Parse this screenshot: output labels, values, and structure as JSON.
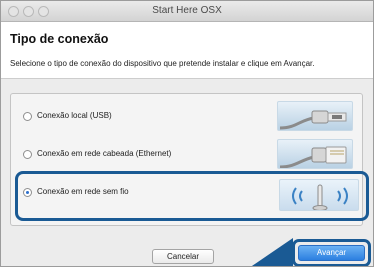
{
  "window": {
    "title": "Start Here OSX"
  },
  "header": {
    "title": "Tipo de conexão",
    "instruction": "Selecione o tipo de conexão do dispositivo que pretende instalar e clique em Avançar."
  },
  "options": [
    {
      "label": "Conexão local (USB)",
      "selected": false,
      "icon": "usb-cable-icon"
    },
    {
      "label": "Conexão em rede cabeada (Ethernet)",
      "selected": false,
      "icon": "ethernet-cable-icon"
    },
    {
      "label": "Conexão em rede sem fio",
      "selected": true,
      "icon": "wireless-icon"
    }
  ],
  "buttons": {
    "cancel": "Cancelar",
    "next": "Avançar"
  },
  "colors": {
    "highlight": "#1a5a94",
    "primary_button": "#2c7fe0"
  }
}
